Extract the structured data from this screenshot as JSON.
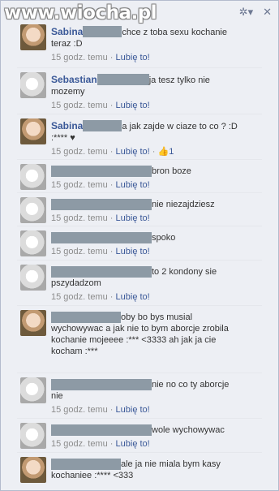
{
  "watermark": "www.wiocha.pl",
  "controls": {
    "settings": "✲▾",
    "close": "✕"
  },
  "meta": {
    "time": "15 godz. temu",
    "sep": "·",
    "like": "Lubię to!"
  },
  "posts": [
    {
      "author": "Sabina",
      "line1": "chce z toba sexu kochanie",
      "line2": "teraz :D"
    },
    {
      "author": "Sebastian",
      "line1": "ja tesz tylko nie",
      "line2": "mozemy"
    },
    {
      "author": "Sabina",
      "line1": "a jak zajde w ciaze to co ? :D",
      "line2": ":**** ♥",
      "likes": "1"
    },
    {
      "line1": "bron boze"
    },
    {
      "line1": "nie niezajdziesz"
    },
    {
      "line1": "spoko"
    },
    {
      "line1": "to 2 kondony sie",
      "line2": "pszydadzom"
    },
    {
      "line1": "oby bo bys musial",
      "line2": "wychowywac a jak nie to bym aborcje zrobila",
      "line3": "kochanie mojeeee :*** <3333 ah jak ja cie",
      "line4": "kocham :***"
    },
    {
      "line1": "nie no co ty aborcje",
      "line2": "nie"
    },
    {
      "line1": "wole wychowywac"
    },
    {
      "line1": "ale ja nie miala bym kasy",
      "line2": "kochaniee :**** <333"
    }
  ]
}
